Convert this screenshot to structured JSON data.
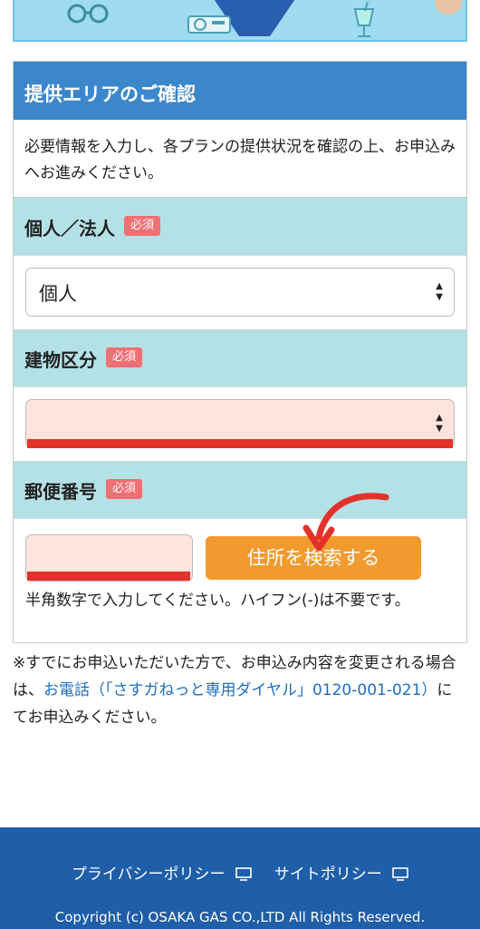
{
  "card": {
    "title": "提供エリアのご確認",
    "intro": "必要情報を入力し、各プランの提供状況を確認の上、お申込みへお進みください。"
  },
  "fields": {
    "customer_type": {
      "label": "個人／法人",
      "required": "必須",
      "value": "個人"
    },
    "building_type": {
      "label": "建物区分",
      "required": "必須",
      "value": ""
    },
    "postal_code": {
      "label": "郵便番号",
      "required": "必須",
      "value": "",
      "button": "住所を検索する",
      "hint": "半角数字で入力してください。ハイフン(-)は不要です。"
    }
  },
  "note": {
    "before": "※すでにお申込いただいた方で、お申込み内容を変更される場合は、",
    "link": "お電話（「さすガねっと専用ダイヤル」0120-001-021）",
    "after": "にてお申込みください。"
  },
  "footer": {
    "privacy": "プライバシーポリシー",
    "site": "サイトポリシー",
    "copyright": "Copyright (c) OSAKA GAS CO.,LTD All Rights Reserved."
  },
  "colors": {
    "header_blue": "#3c87cb",
    "label_bg": "#b4e1e6",
    "required_badge": "#ef6f74",
    "search_button": "#f19a2e",
    "empty_field": "#ffe4de",
    "annotation_red": "#e3322a",
    "footer_blue": "#1f5ea8",
    "link_blue": "#1e6fbf"
  },
  "icons": [
    "glasses-icon",
    "projector-icon",
    "drink-icon",
    "external-window-icon",
    "arrow-annotation-icon"
  ]
}
